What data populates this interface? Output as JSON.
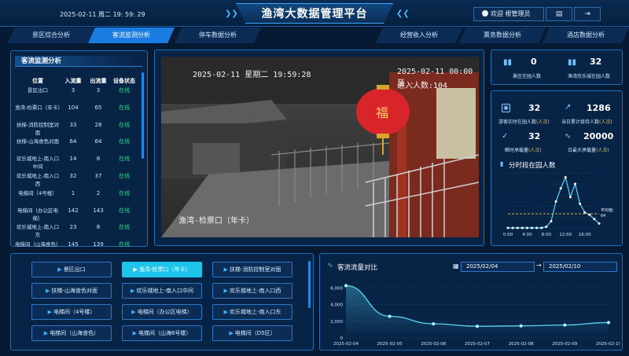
{
  "header": {
    "datetime": "2025-02-11 周二 19: 59: 29",
    "title": "渔湾大数据管理平台",
    "user": "欢迎 根管理员"
  },
  "nav": {
    "tabs": [
      {
        "label": "景区综合分析",
        "active": false
      },
      {
        "label": "客流监测分析",
        "active": true
      },
      {
        "label": "停车数据分析",
        "active": false
      },
      {
        "label": "经营收入分析",
        "active": false
      },
      {
        "label": "票务数据分析",
        "active": false
      },
      {
        "label": "酒店数据分析",
        "active": false
      }
    ]
  },
  "left_panel": {
    "title": "客流监测分析",
    "headers": [
      "位置",
      "入流量",
      "出流量",
      "设备状态"
    ],
    "rows": [
      {
        "pos": "景区出口",
        "in": "3",
        "out": "3",
        "status": "在线"
      },
      {
        "pos": "渔湾-检票口（年卡）",
        "in": "104",
        "out": "65",
        "status": "在线"
      },
      {
        "pos": "扶梯-消防控制室对面",
        "in": "33",
        "out": "28",
        "status": "在线"
      },
      {
        "pos": "扶梯-山海食色对面",
        "in": "64",
        "out": "64",
        "status": "在线"
      },
      {
        "pos": "欢乐城地上-南入口中间",
        "in": "14",
        "out": "8",
        "status": "在线"
      },
      {
        "pos": "欢乐城地上-南入口西",
        "in": "32",
        "out": "37",
        "status": "在线"
      },
      {
        "pos": "电梯间（4号楼）",
        "in": "1",
        "out": "2",
        "status": "在线"
      },
      {
        "pos": "电梯间（办公区电梯）",
        "in": "142",
        "out": "143",
        "status": "在线"
      },
      {
        "pos": "欢乐城地上-南入口东",
        "in": "23",
        "out": "8",
        "status": "在线"
      },
      {
        "pos": "电梯间（山海食色）",
        "in": "145",
        "out": "139",
        "status": "在线"
      }
    ]
  },
  "camera": {
    "osd_datetime": "2025-02-11 星期二 19:59:28",
    "osd_right_datetime": "2025-02-11 00:00 至 -",
    "osd_count": "进入人数:104",
    "osd_name": "渔湾-检票口（年卡）",
    "lantern_char": "福"
  },
  "right_top": {
    "items": [
      {
        "icon": "bar-chart-icon",
        "value": "0",
        "label": "景区在园人数"
      },
      {
        "icon": "bar-chart-icon",
        "value": "32",
        "label": "渔湾欢乐城在园人数"
      }
    ]
  },
  "right_stats": {
    "items": [
      {
        "value": "32",
        "label": "游客实时在园人数",
        "unit": "(人次)"
      },
      {
        "value": "1286",
        "label": "当日累计接待人数",
        "unit": "(人次)"
      },
      {
        "value": "32",
        "label": "瞬时承载量",
        "unit": "(人次)"
      },
      {
        "value": "20000",
        "label": "日最大承载量",
        "unit": "(人次)"
      }
    ],
    "chart_title": "分时段在园人数",
    "avg_label": "平均值:",
    "avg_value": "64"
  },
  "gate_buttons": [
    {
      "label": "景区出口",
      "active": false
    },
    {
      "label": "渔湾-检票口（年卡）",
      "active": true
    },
    {
      "label": "扶梯-消防控制室对面",
      "active": false
    },
    {
      "label": "扶梯-山海食色对面",
      "active": false
    },
    {
      "label": "欢乐城地上-南入口中间",
      "active": false
    },
    {
      "label": "欢乐城地上-南入口西",
      "active": false
    },
    {
      "label": "电梯间（4号楼）",
      "active": false
    },
    {
      "label": "电梯间（办公区电梯）",
      "active": false
    },
    {
      "label": "欢乐城地上-南入口东",
      "active": false
    },
    {
      "label": "电梯间（山海食色）",
      "active": false
    },
    {
      "label": "电梯间（山海6号楼）",
      "active": false
    },
    {
      "label": "电梯间（D5区）",
      "active": false
    }
  ],
  "flow": {
    "title": "客流流量对比",
    "start_date": "2025/02/04",
    "end_date": "2025/02/10",
    "arrow": "→"
  },
  "chart_data": [
    {
      "type": "line",
      "title": "分时段在园人数",
      "x_ticks": [
        "0:00",
        "4:00",
        "8:00",
        "12:00",
        "16:00"
      ],
      "x": [
        0,
        1,
        2,
        3,
        4,
        5,
        6,
        7,
        8,
        9,
        10,
        11,
        12,
        13,
        14,
        15,
        16,
        17,
        18,
        19
      ],
      "values": [
        0,
        0,
        0,
        0,
        0,
        0,
        0,
        0,
        5,
        30,
        120,
        180,
        230,
        140,
        200,
        110,
        70,
        60,
        40,
        20
      ],
      "ylim": [
        0,
        250
      ],
      "y_ticks": [
        0,
        50,
        100,
        150,
        200,
        250
      ],
      "avg_value": 64
    },
    {
      "type": "area",
      "title": "客流流量对比",
      "categories": [
        "2025-02-04",
        "2025-02-05",
        "2025-02-06",
        "2025-02-07",
        "2025-02-08",
        "2025-02-09",
        "2025-02-10"
      ],
      "values": [
        6300,
        2600,
        1700,
        1400,
        1450,
        1550,
        1850
      ],
      "ylim": [
        0,
        7000
      ],
      "y_ticks": [
        0,
        2000,
        4000,
        6000
      ],
      "color": "#5ad6f5"
    }
  ]
}
